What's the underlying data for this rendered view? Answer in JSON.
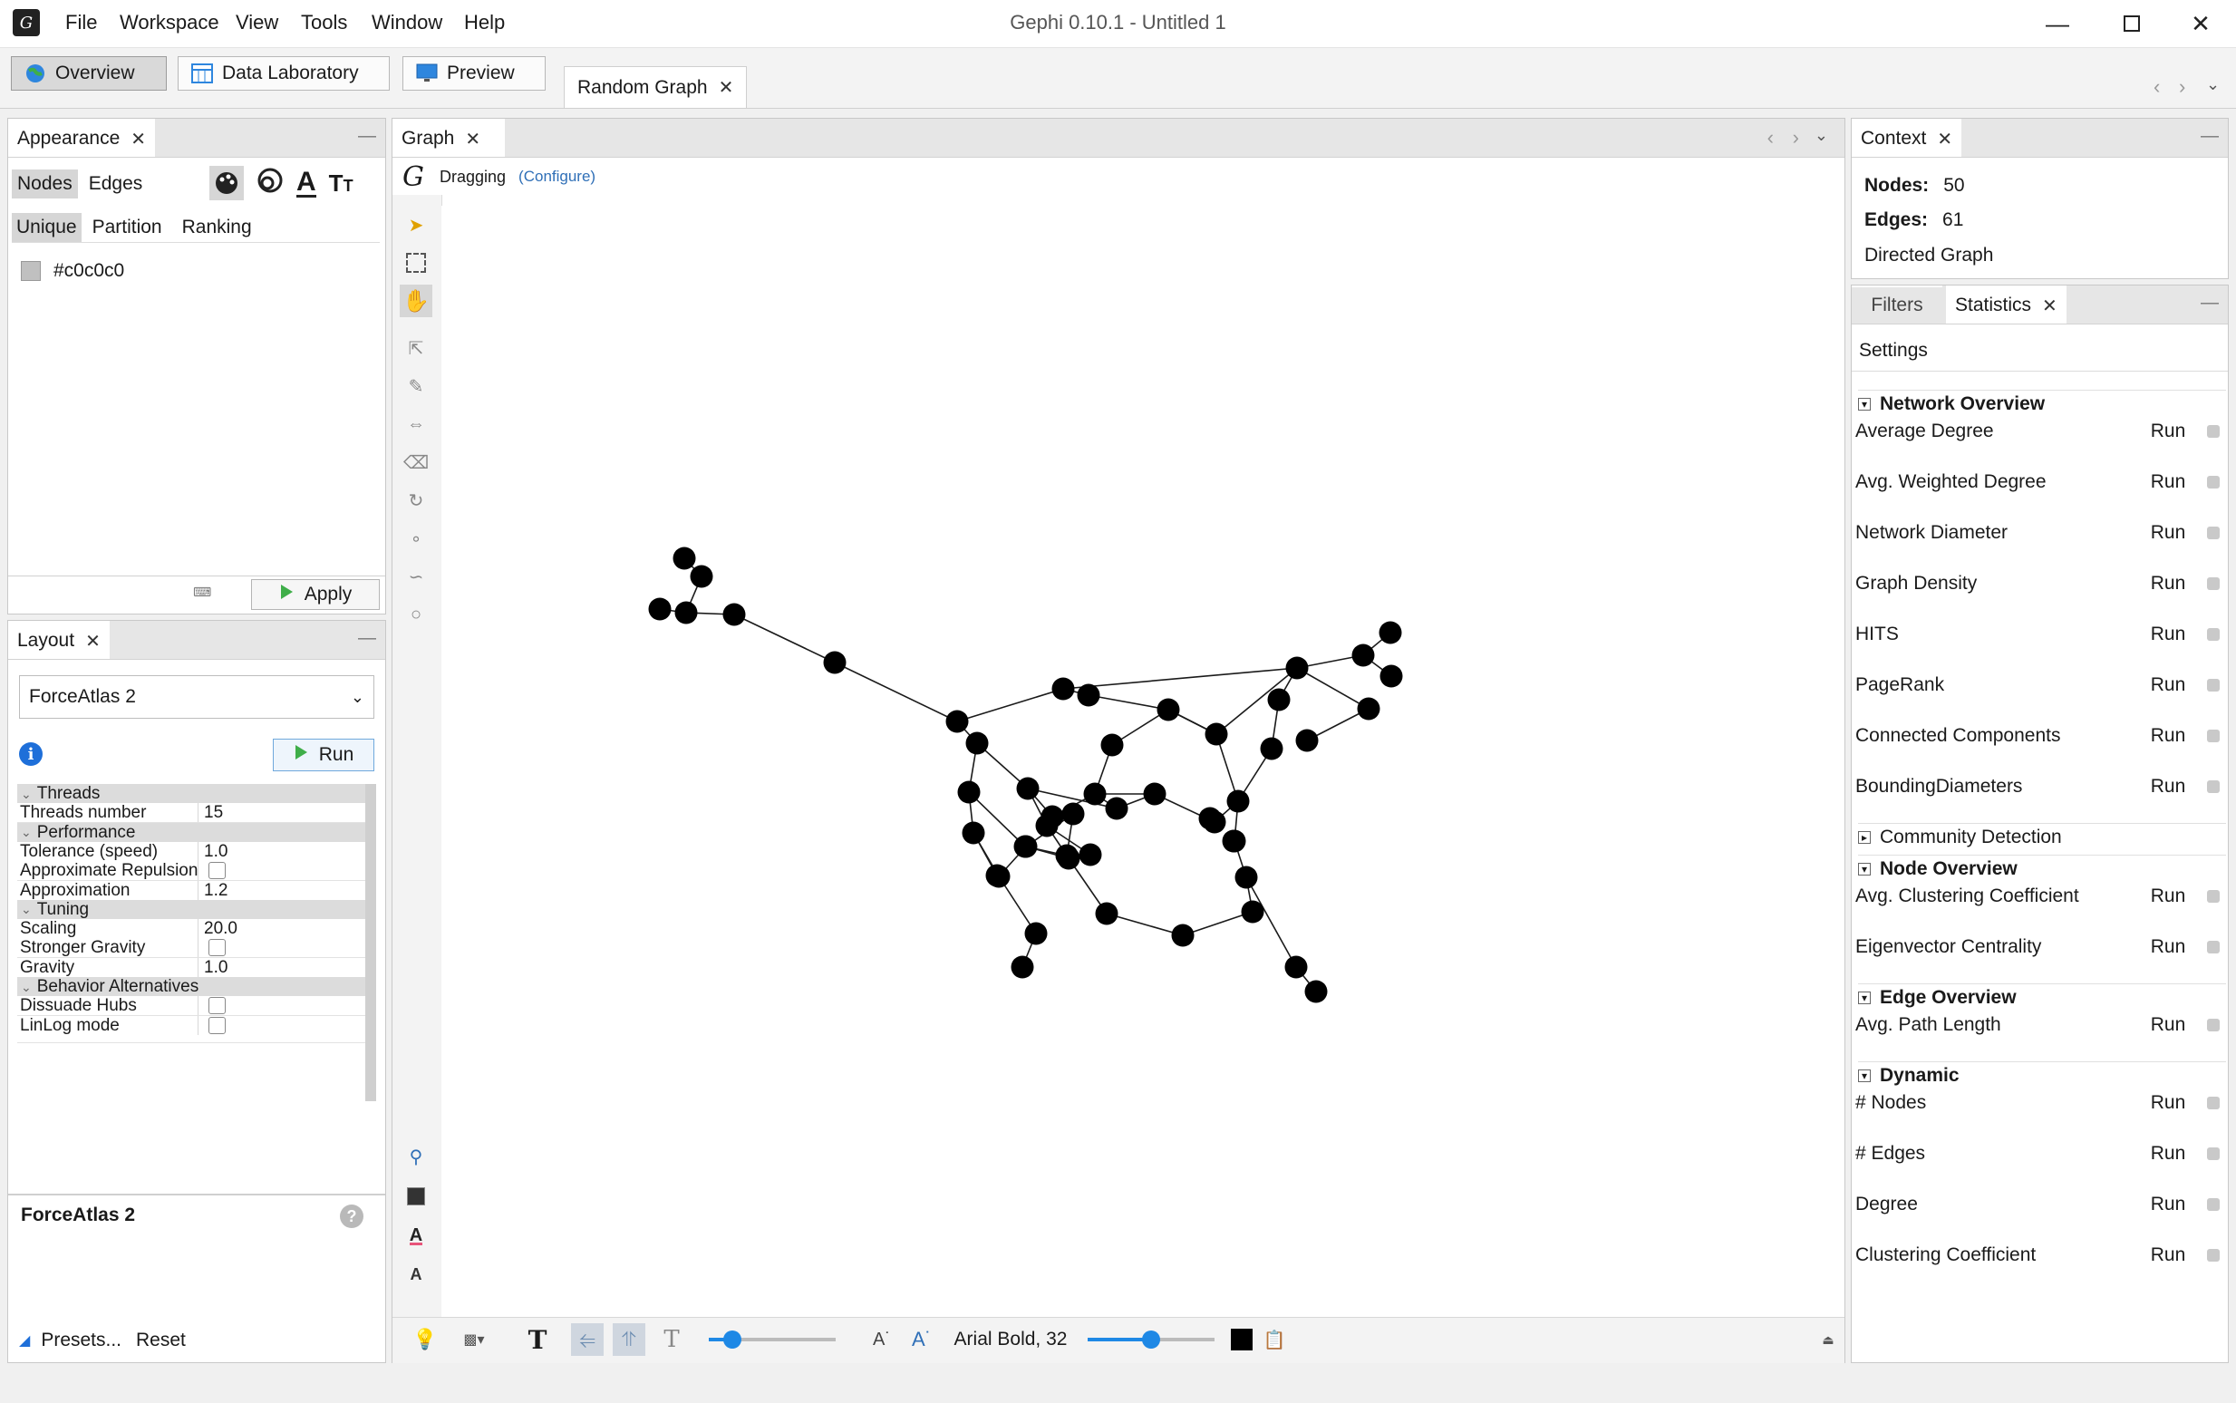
{
  "app": {
    "title": "Gephi 0.10.1 - Untitled 1",
    "menu": [
      "File",
      "Workspace",
      "View",
      "Tools",
      "Window",
      "Help"
    ]
  },
  "toolbar": {
    "overview": "Overview",
    "data_laboratory": "Data Laboratory",
    "preview": "Preview",
    "workspace_tab": "Random Graph"
  },
  "appearance": {
    "title": "Appearance",
    "nodes_tab": "Nodes",
    "edges_tab": "Edges",
    "modes": [
      "Unique",
      "Partition",
      "Ranking"
    ],
    "color_value": "#c0c0c0",
    "apply": "Apply"
  },
  "layout": {
    "title": "Layout",
    "algorithm": "ForceAtlas 2",
    "run": "Run",
    "properties": [
      {
        "type": "group",
        "label": "Threads"
      },
      {
        "type": "text",
        "key": "Threads number",
        "value": "15"
      },
      {
        "type": "group",
        "label": "Performance"
      },
      {
        "type": "text",
        "key": "Tolerance (speed)",
        "value": "1.0"
      },
      {
        "type": "check",
        "key": "Approximate Repulsion",
        "value": ""
      },
      {
        "type": "text",
        "key": "Approximation",
        "value": "1.2"
      },
      {
        "type": "group",
        "label": "Tuning"
      },
      {
        "type": "text",
        "key": "Scaling",
        "value": "20.0"
      },
      {
        "type": "check",
        "key": "Stronger Gravity",
        "value": ""
      },
      {
        "type": "text",
        "key": "Gravity",
        "value": "1.0"
      },
      {
        "type": "group",
        "label": "Behavior Alternatives"
      },
      {
        "type": "check",
        "key": "Dissuade Hubs",
        "value": ""
      },
      {
        "type": "check",
        "key": "LinLog mode",
        "value": ""
      }
    ],
    "description_title": "ForceAtlas 2",
    "presets": "Presets...",
    "reset": "Reset"
  },
  "graph": {
    "tab": "Graph",
    "mode": "Dragging",
    "configure": "(Configure)",
    "font_label": "Arial Bold, 32"
  },
  "context": {
    "title": "Context",
    "nodes_label": "Nodes:",
    "nodes_value": "50",
    "edges_label": "Edges:",
    "edges_value": "61",
    "graph_type": "Directed Graph"
  },
  "statistics": {
    "filters_tab": "Filters",
    "statistics_tab": "Statistics",
    "settings": "Settings",
    "run_label": "Run",
    "sections": [
      {
        "name": "Network Overview",
        "expanded": true,
        "items": [
          "Average Degree",
          "Avg. Weighted Degree",
          "Network Diameter",
          "Graph Density",
          "HITS",
          "PageRank",
          "Connected Components",
          "BoundingDiameters"
        ]
      },
      {
        "name": "Community Detection",
        "expanded": false,
        "items": []
      },
      {
        "name": "Node Overview",
        "expanded": true,
        "items": [
          "Avg. Clustering Coefficient",
          "Eigenvector Centrality"
        ]
      },
      {
        "name": "Edge Overview",
        "expanded": true,
        "items": [
          "Avg. Path Length"
        ]
      },
      {
        "name": "Dynamic",
        "expanded": true,
        "items": [
          "# Nodes",
          "# Edges",
          "Degree",
          "Clustering Coefficient"
        ]
      }
    ]
  },
  "colors": {
    "accent": "#1e88e5",
    "node": "#000000",
    "node_swatch": "#c0c0c0"
  }
}
